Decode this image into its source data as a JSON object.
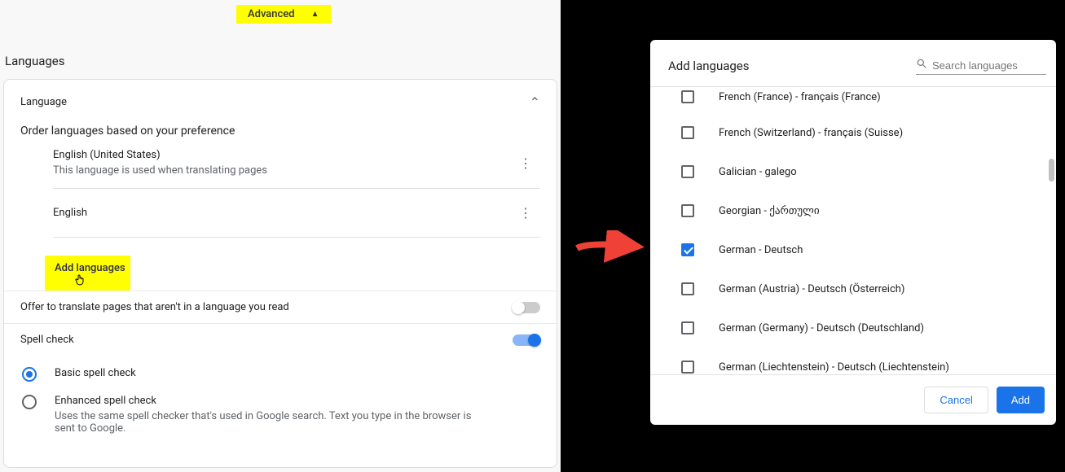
{
  "left": {
    "advanced_label": "Advanced",
    "section_title": "Languages",
    "card_title": "Language",
    "order_text": "Order languages based on your preference",
    "langs": [
      {
        "name": "English (United States)",
        "sub": "This language is used when translating pages"
      },
      {
        "name": "English",
        "sub": ""
      }
    ],
    "add_languages_label": "Add languages",
    "offer_translate_label": "Offer to translate pages that aren't in a language you read",
    "spell_check_label": "Spell check",
    "spell_options": [
      {
        "main": "Basic spell check",
        "sub": "",
        "selected": true
      },
      {
        "main": "Enhanced spell check",
        "sub": "Uses the same spell checker that's used in Google search. Text you type in the browser is sent to Google.",
        "selected": false
      }
    ]
  },
  "dialog": {
    "title": "Add languages",
    "search_placeholder": "Search languages",
    "options": [
      {
        "label": "French (France) - français (France)",
        "checked": false,
        "cut": true
      },
      {
        "label": "French (Switzerland) - français (Suisse)",
        "checked": false
      },
      {
        "label": "Galician - galego",
        "checked": false
      },
      {
        "label": "Georgian - ქართული",
        "checked": false
      },
      {
        "label": "German - Deutsch",
        "checked": true
      },
      {
        "label": "German (Austria) - Deutsch (Österreich)",
        "checked": false
      },
      {
        "label": "German (Germany) - Deutsch (Deutschland)",
        "checked": false
      },
      {
        "label": "German (Liechtenstein) - Deutsch (Liechtenstein)",
        "checked": false
      }
    ],
    "cancel_label": "Cancel",
    "add_label": "Add"
  }
}
